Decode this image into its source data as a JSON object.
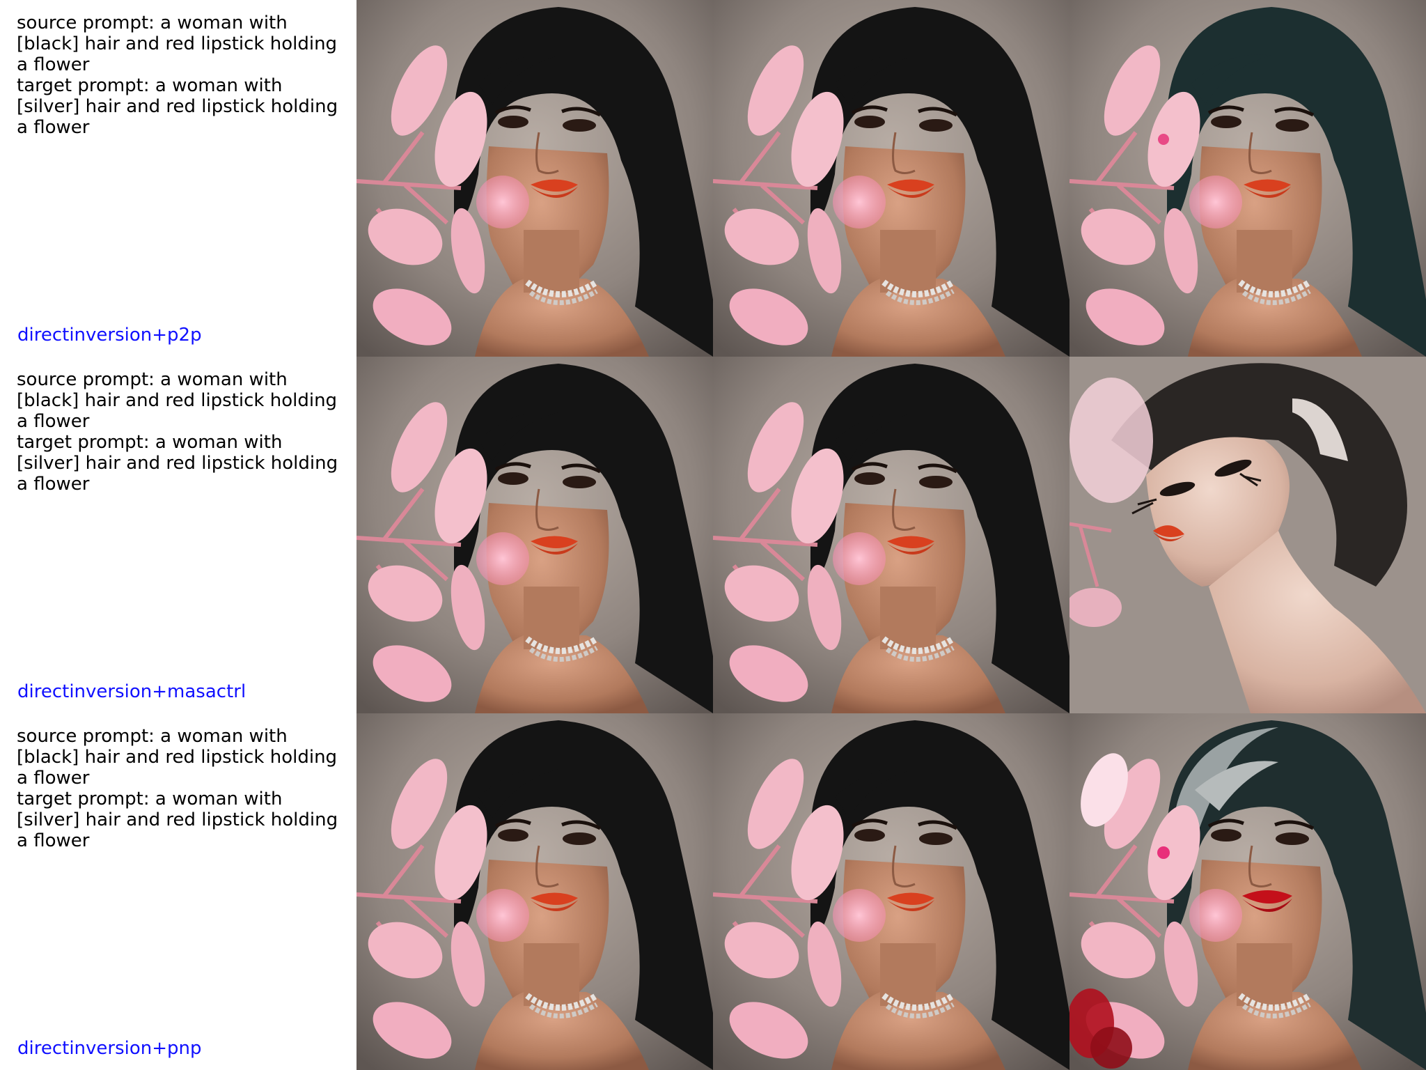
{
  "rows": [
    {
      "source_prompt": "source prompt: a woman with [black] hair and red lipstick holding a flower",
      "target_prompt": "target prompt: a woman with [silver] hair and red lipstick holding a flower",
      "method": "directinversion+p2p"
    },
    {
      "source_prompt": "source prompt: a woman with [black] hair and red lipstick holding a flower",
      "target_prompt": "target prompt: a woman with [silver] hair and red lipstick holding a flower",
      "method": "directinversion+masactrl"
    },
    {
      "source_prompt": "source prompt: a woman with [black] hair and red lipstick holding a flower",
      "target_prompt": "target prompt: a woman with [silver] hair and red lipstick holding a flower",
      "method": "directinversion+pnp"
    }
  ],
  "colors": {
    "method_label": "#1010ff",
    "hair_black": "#141414",
    "hair_silver": "#9aa2a3",
    "hair_teal": "#1c2f30",
    "lips_orange": "#d9401f",
    "lips_red": "#c4101a",
    "leaf_pink": "#f2b8c6"
  }
}
